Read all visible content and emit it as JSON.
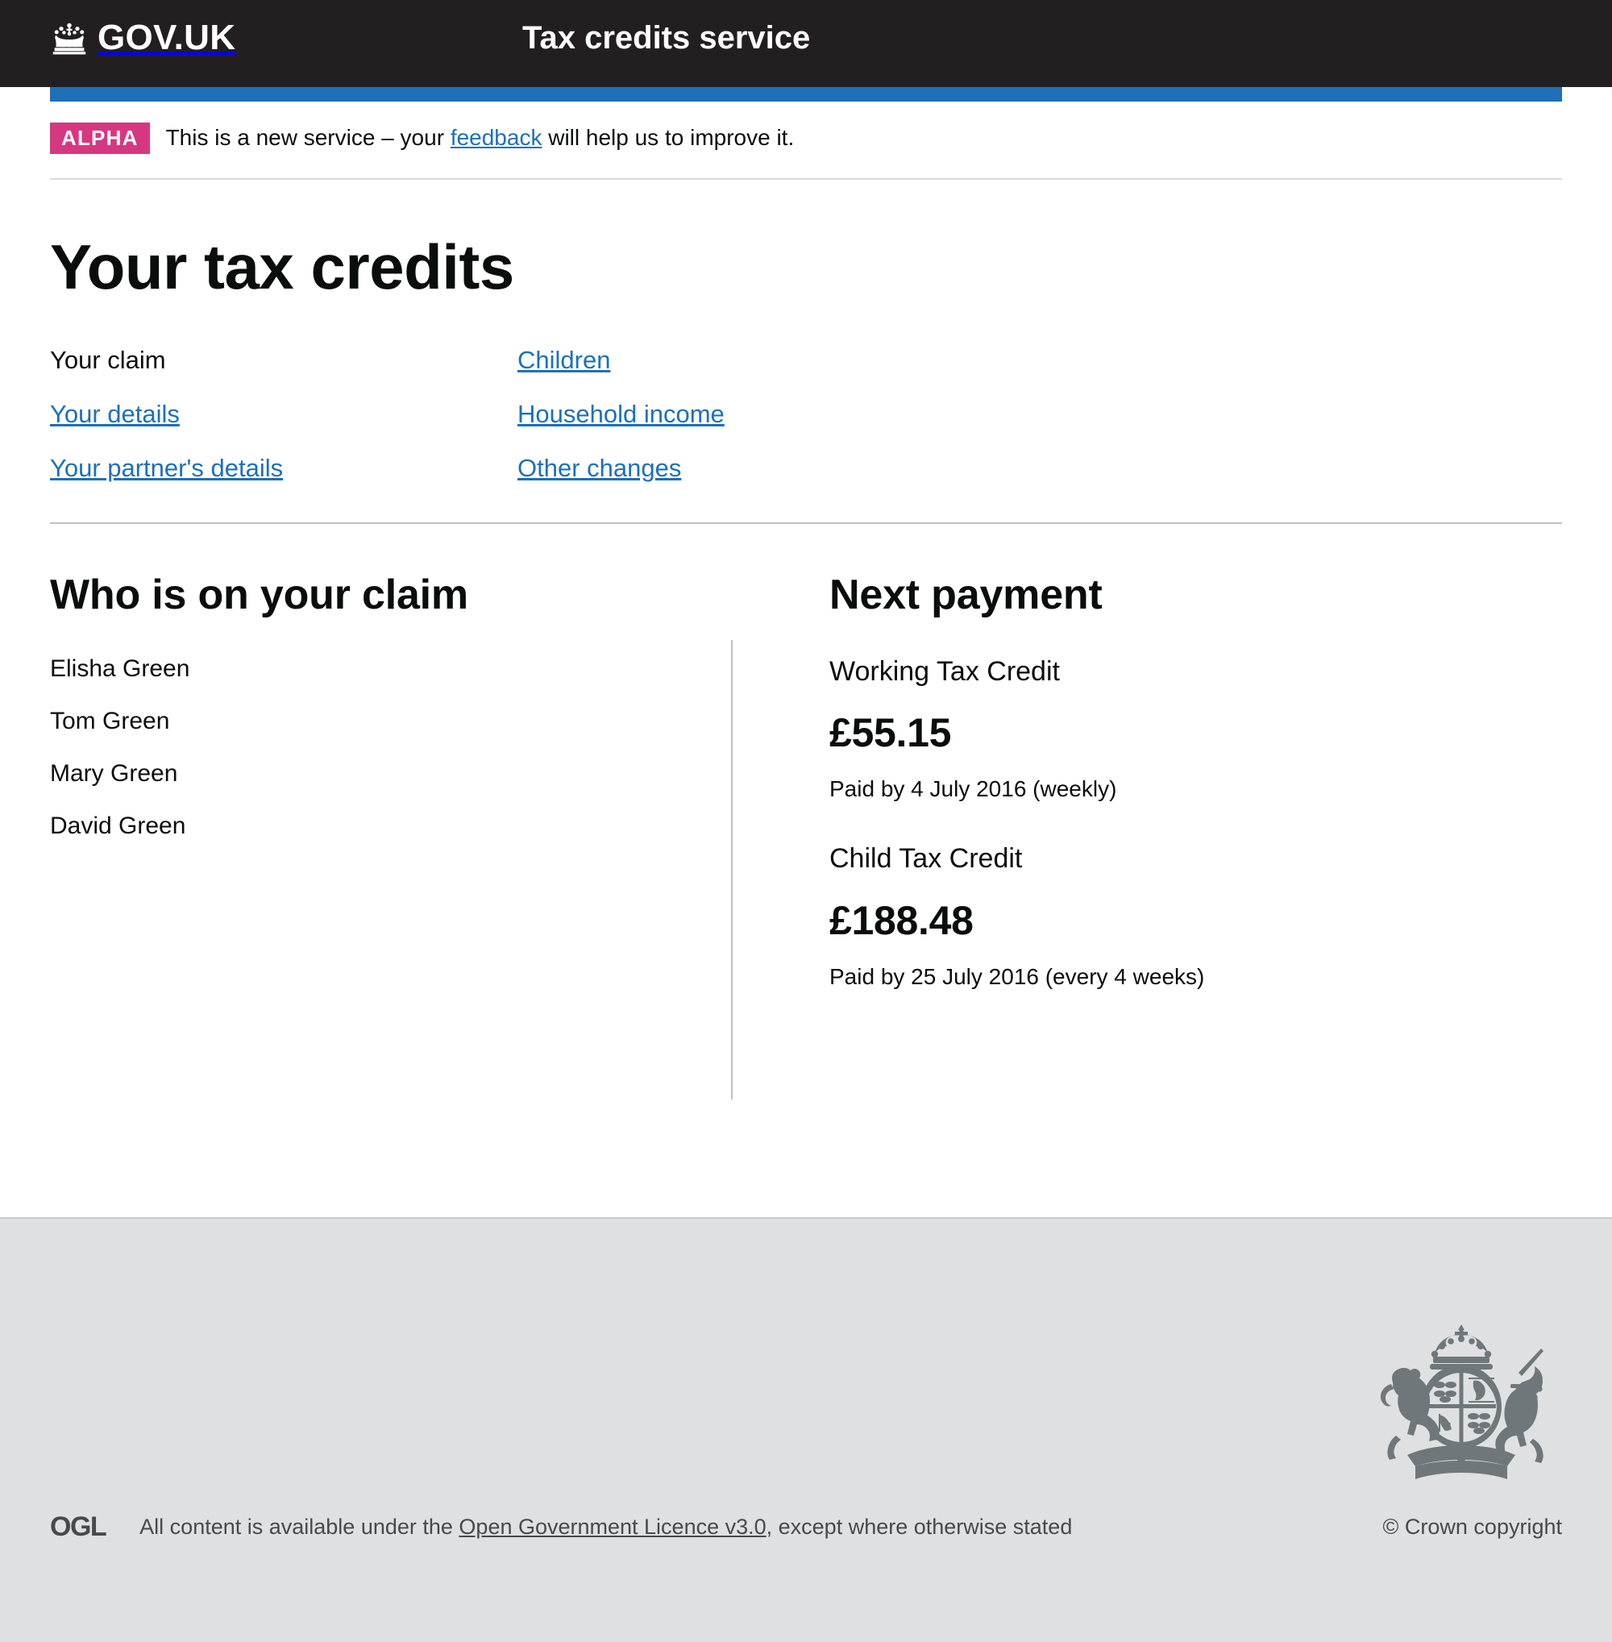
{
  "header": {
    "brand_name": "GOV.UK",
    "crown_icon": "crown-icon",
    "service_name": "Tax credits service",
    "background_color": "#231f20",
    "accent_bar_color": "#1d70b8"
  },
  "phase_banner": {
    "tag": "ALPHA",
    "tag_color": "#d53880",
    "text_before": "This is a new service – your ",
    "link_text": "feedback",
    "text_after": " will help us to improve it."
  },
  "main": {
    "page_title": "Your tax credits",
    "nav_links": [
      {
        "label": "Your claim",
        "is_link": false
      },
      {
        "label": "Children",
        "is_link": true
      },
      {
        "label": "Your details",
        "is_link": true
      },
      {
        "label": "Household income",
        "is_link": true
      },
      {
        "label": "Your partner's details",
        "is_link": true
      },
      {
        "label": "Other changes",
        "is_link": true
      }
    ],
    "claim_section": {
      "title": "Who is on your claim",
      "people": [
        "Elisha Green",
        "Tom Green",
        "Mary Green",
        "David Green"
      ]
    },
    "payment_section": {
      "title": "Next payment",
      "payments": [
        {
          "label": "Working Tax Credit",
          "amount": "£55.15",
          "date": "Paid by 4 July 2016 (weekly)"
        },
        {
          "label": "Child Tax Credit",
          "amount": "£188.48",
          "date": "Paid by 25 July 2016 (every 4 weeks)"
        }
      ]
    }
  },
  "footer": {
    "royal_arms_icon": "royal-coat-of-arms-icon",
    "ogl_logo": "OGL",
    "licence_before": "All content is available under the ",
    "licence_link": "Open Government Licence v3.0",
    "licence_after": ", except where otherwise stated",
    "copyright": "© Crown copyright",
    "background_color": "#dee0e2",
    "text_color": "#454a4c"
  },
  "link_color": "#1d70b8"
}
